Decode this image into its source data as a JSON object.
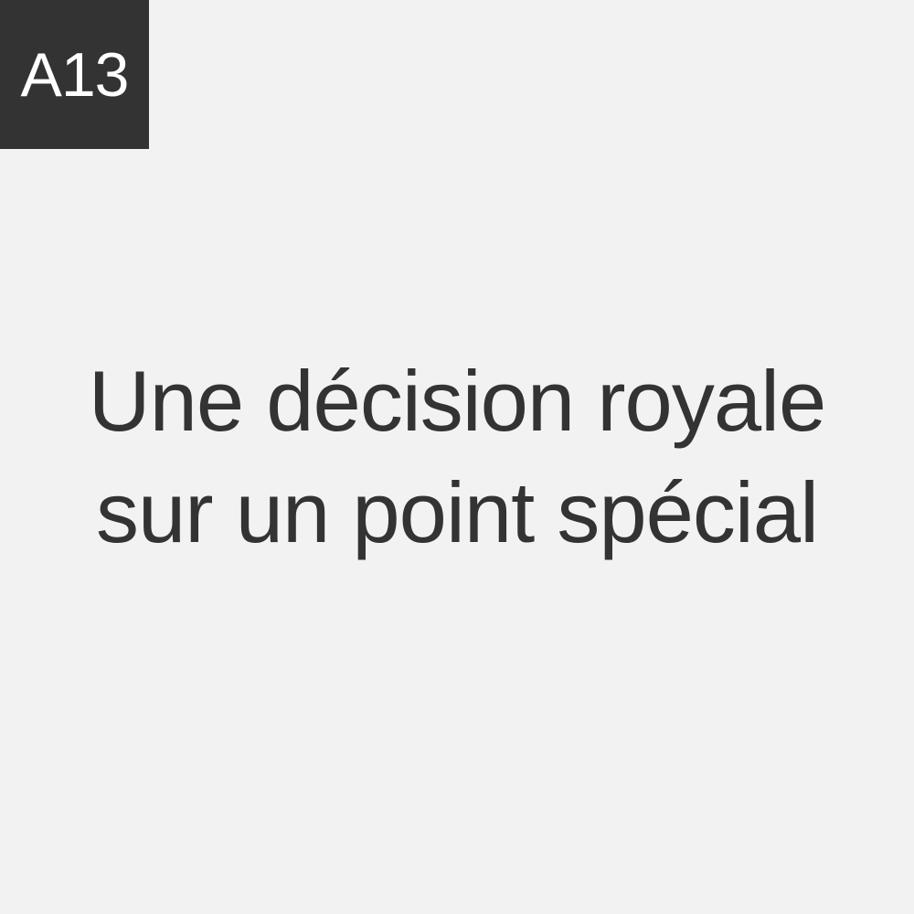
{
  "card": {
    "code": "A13",
    "phrase_lines": [
      "Une décision royale",
      "sur un point spécial"
    ]
  },
  "colors": {
    "background": "#f2f2f2",
    "badge_background": "#333333",
    "badge_text": "#ffffff",
    "text": "#333333"
  }
}
